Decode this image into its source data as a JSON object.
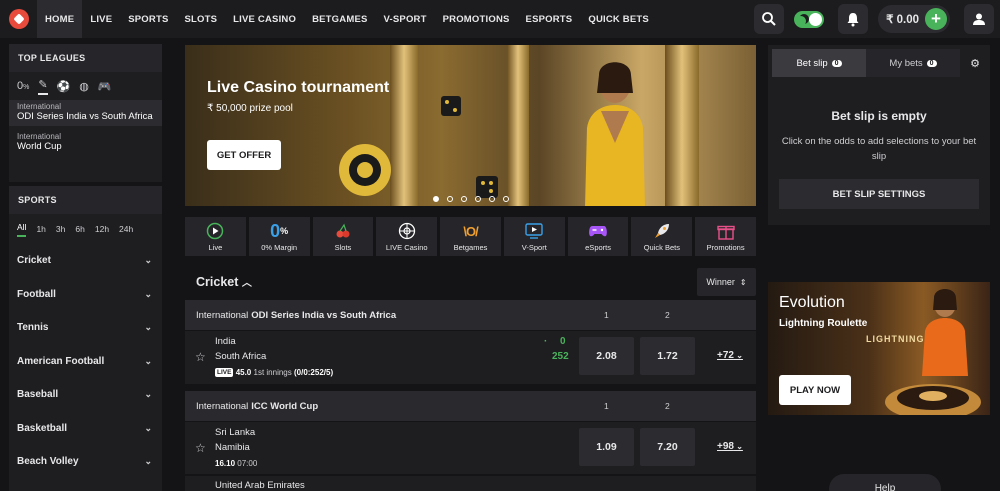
{
  "nav": {
    "items": [
      "HOME",
      "LIVE",
      "SPORTS",
      "SLOTS",
      "LIVE CASINO",
      "BETGAMES",
      "V-SPORT",
      "PROMOTIONS",
      "ESPORTS",
      "QUICK BETS"
    ],
    "active": "HOME"
  },
  "header": {
    "balance": "₹ 0.00",
    "plus": "+"
  },
  "top_leagues": {
    "title": "TOP LEAGUES",
    "leagues": [
      {
        "category": "International",
        "name": "ODI Series India vs South Africa"
      },
      {
        "category": "International",
        "name": "World Cup"
      }
    ]
  },
  "sports_panel": {
    "title": "SPORTS",
    "time_tabs": [
      "All",
      "1h",
      "3h",
      "6h",
      "12h",
      "24h"
    ],
    "sports": [
      "Cricket",
      "Football",
      "Tennis",
      "American Football",
      "Baseball",
      "Basketball",
      "Beach Volley"
    ]
  },
  "banner": {
    "title": "Live Casino tournament",
    "subtitle": "₹ 50,000 prize pool",
    "button": "GET OFFER"
  },
  "quick_links": [
    {
      "label": "Live",
      "icon": "play-icon"
    },
    {
      "label": "0% Margin",
      "icon": "zero-percent-icon"
    },
    {
      "label": "Slots",
      "icon": "cherry-icon"
    },
    {
      "label": "LIVE Casino",
      "icon": "roulette-icon"
    },
    {
      "label": "Betgames",
      "icon": "betgames-icon"
    },
    {
      "label": "V-Sport",
      "icon": "monitor-icon"
    },
    {
      "label": "eSports",
      "icon": "gamepad-icon"
    },
    {
      "label": "Quick Bets",
      "icon": "rocket-icon"
    },
    {
      "label": "Promotions",
      "icon": "gift-icon"
    }
  ],
  "main": {
    "sport_title": "Cricket",
    "market_select": "Winner",
    "events": [
      {
        "category": "International",
        "tournament": "ODI Series India vs South Africa",
        "col1": "1",
        "col2": "2",
        "match": {
          "home": "India",
          "away": "South Africa",
          "home_score": "0",
          "away_score": "252",
          "odd1": "2.08",
          "odd2": "1.72",
          "more": "+72",
          "live": "LIVE",
          "status_bold": "45.0",
          "status": "1st innings",
          "score_detail": "(0/0:252/5)"
        }
      },
      {
        "category": "International",
        "tournament": "ICC World Cup",
        "col1": "1",
        "col2": "2",
        "match": {
          "home": "Sri Lanka",
          "away": "Namibia",
          "odd1": "1.09",
          "odd2": "7.20",
          "more": "+98",
          "date": "16.10",
          "time": "07:00"
        },
        "next_match": {
          "home": "United Arab Emirates"
        }
      }
    ]
  },
  "betslip": {
    "tab_slip": "Bet slip",
    "tab_slip_count": "0",
    "tab_mybets": "My bets",
    "tab_mybets_count": "0",
    "empty_title": "Bet slip is empty",
    "empty_hint": "Click on the odds to add selections to your bet slip",
    "settings_button": "BET SLIP SETTINGS"
  },
  "promo": {
    "title": "Evolution",
    "subtitle": "Lightning Roulette",
    "button": "PLAY NOW",
    "art_text": "LIGHTNING ROULETTE"
  },
  "help": "Help",
  "colors": {
    "accent_green": "#49b35b",
    "background": "#141416",
    "panel": "#1e1e21",
    "brand_red": "#e84b3c"
  }
}
